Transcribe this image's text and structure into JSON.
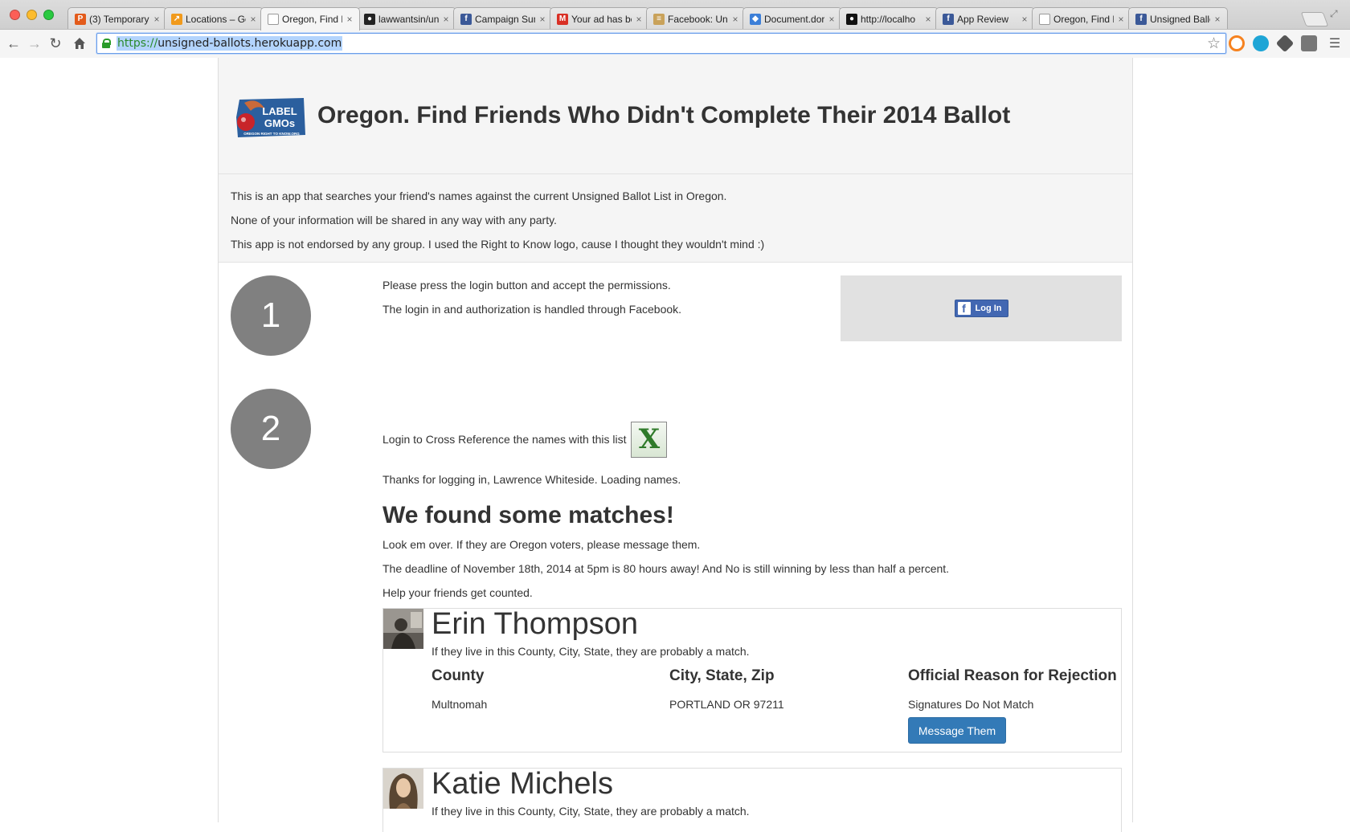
{
  "browser": {
    "tabs": [
      {
        "title": "(3) Temporary",
        "favicon_color": "#e35b1b",
        "favicon_glyph": "P"
      },
      {
        "title": "Locations – Go",
        "favicon_color": "#f19a1c",
        "favicon_glyph": "↗"
      },
      {
        "title": "Oregon, Find F",
        "favicon_color": "#ffffff",
        "favicon_glyph": "",
        "active": true
      },
      {
        "title": "lawwantsin/un",
        "favicon_color": "#222222",
        "favicon_glyph": "●"
      },
      {
        "title": "Campaign Sum",
        "favicon_color": "#3b5998",
        "favicon_glyph": "f"
      },
      {
        "title": "Your ad has be",
        "favicon_color": "#d93025",
        "favicon_glyph": "M"
      },
      {
        "title": "Facebook: Uns",
        "favicon_color": "#c9a25a",
        "favicon_glyph": "≡"
      },
      {
        "title": "Document.dor",
        "favicon_color": "#3c7fd8",
        "favicon_glyph": "◆"
      },
      {
        "title": "http://localho",
        "favicon_color": "#111111",
        "favicon_glyph": "●"
      },
      {
        "title": "App Review",
        "favicon_color": "#3b5998",
        "favicon_glyph": "f"
      },
      {
        "title": "Oregon, Find F",
        "favicon_color": "#ffffff",
        "favicon_glyph": ""
      },
      {
        "title": "Unsigned Ballo",
        "favicon_color": "#3b5998",
        "favicon_glyph": "f"
      }
    ],
    "url_scheme": "https://",
    "url_rest": "unsigned-ballots.herokuapp.com"
  },
  "header": {
    "logo_text_top": "LABEL",
    "logo_text_bottom": "GMOs",
    "logo_tagline": "OREGON RIGHT TO KNOW.ORG",
    "title": "Oregon. Find Friends Who Didn't Complete Their 2014 Ballot"
  },
  "intro": {
    "line1": "This is an app that searches your friend's names against the current Unsigned Ballot List in Oregon.",
    "line2": "None of your information will be shared in any way with any party.",
    "line3": "This app is not endorsed by any group. I used the Right to Know logo, cause I thought they wouldn't mind :)"
  },
  "step1": {
    "number": "1",
    "line1": "Please press the login button and accept the permissions.",
    "line2": "The login in and authorization is handled through Facebook.",
    "login_label": "Log In"
  },
  "step2": {
    "number": "2",
    "xref_text": "Login to Cross Reference the names with this list",
    "thanks": "Thanks for logging in, Lawrence Whiteside. Loading names.",
    "matches_title": "We found some matches!",
    "matches_line1": "Look em over. If they are Oregon voters, please message them.",
    "matches_line2": "The deadline of November 18th, 2014 at 5pm is 80 hours away! And No is still winning by less than half a percent.",
    "matches_line3": "Help your friends get counted."
  },
  "matches": [
    {
      "name": "Erin Thompson",
      "note": "If they live in this County, City, State, they are probably a match.",
      "county_label": "County",
      "county": "Multnomah",
      "city_label": "City, State, Zip",
      "city": "PORTLAND OR 97211",
      "reason_label": "Official Reason for Rejection",
      "reason": "Signatures Do Not Match",
      "button_label": "Message Them"
    },
    {
      "name": "Katie Michels",
      "note": "If they live in this County, City, State, they are probably a match."
    }
  ]
}
